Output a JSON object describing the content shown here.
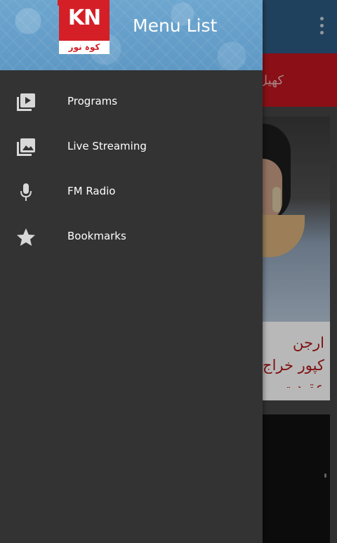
{
  "header": {
    "title": "Menu List",
    "logo_letters": "KN",
    "logo_subtitle": "کوہ نور"
  },
  "menu": {
    "items": [
      {
        "label": "Programs",
        "icon": "video-library-icon"
      },
      {
        "label": "Live Streaming",
        "icon": "photo-library-icon"
      },
      {
        "label": "FM Radio",
        "icon": "microphone-icon"
      },
      {
        "label": "Bookmarks",
        "icon": "star-icon"
      }
    ]
  },
  "background": {
    "band_text": "کھیل",
    "headline": "ارجن کپور خراج عقیدت"
  },
  "colors": {
    "drawer_bg": "#333333",
    "header_blue": "#6da6cf",
    "brand_red": "#d41f26",
    "headline_red": "#b01a1a",
    "icon_gray": "#d8d8d8"
  }
}
